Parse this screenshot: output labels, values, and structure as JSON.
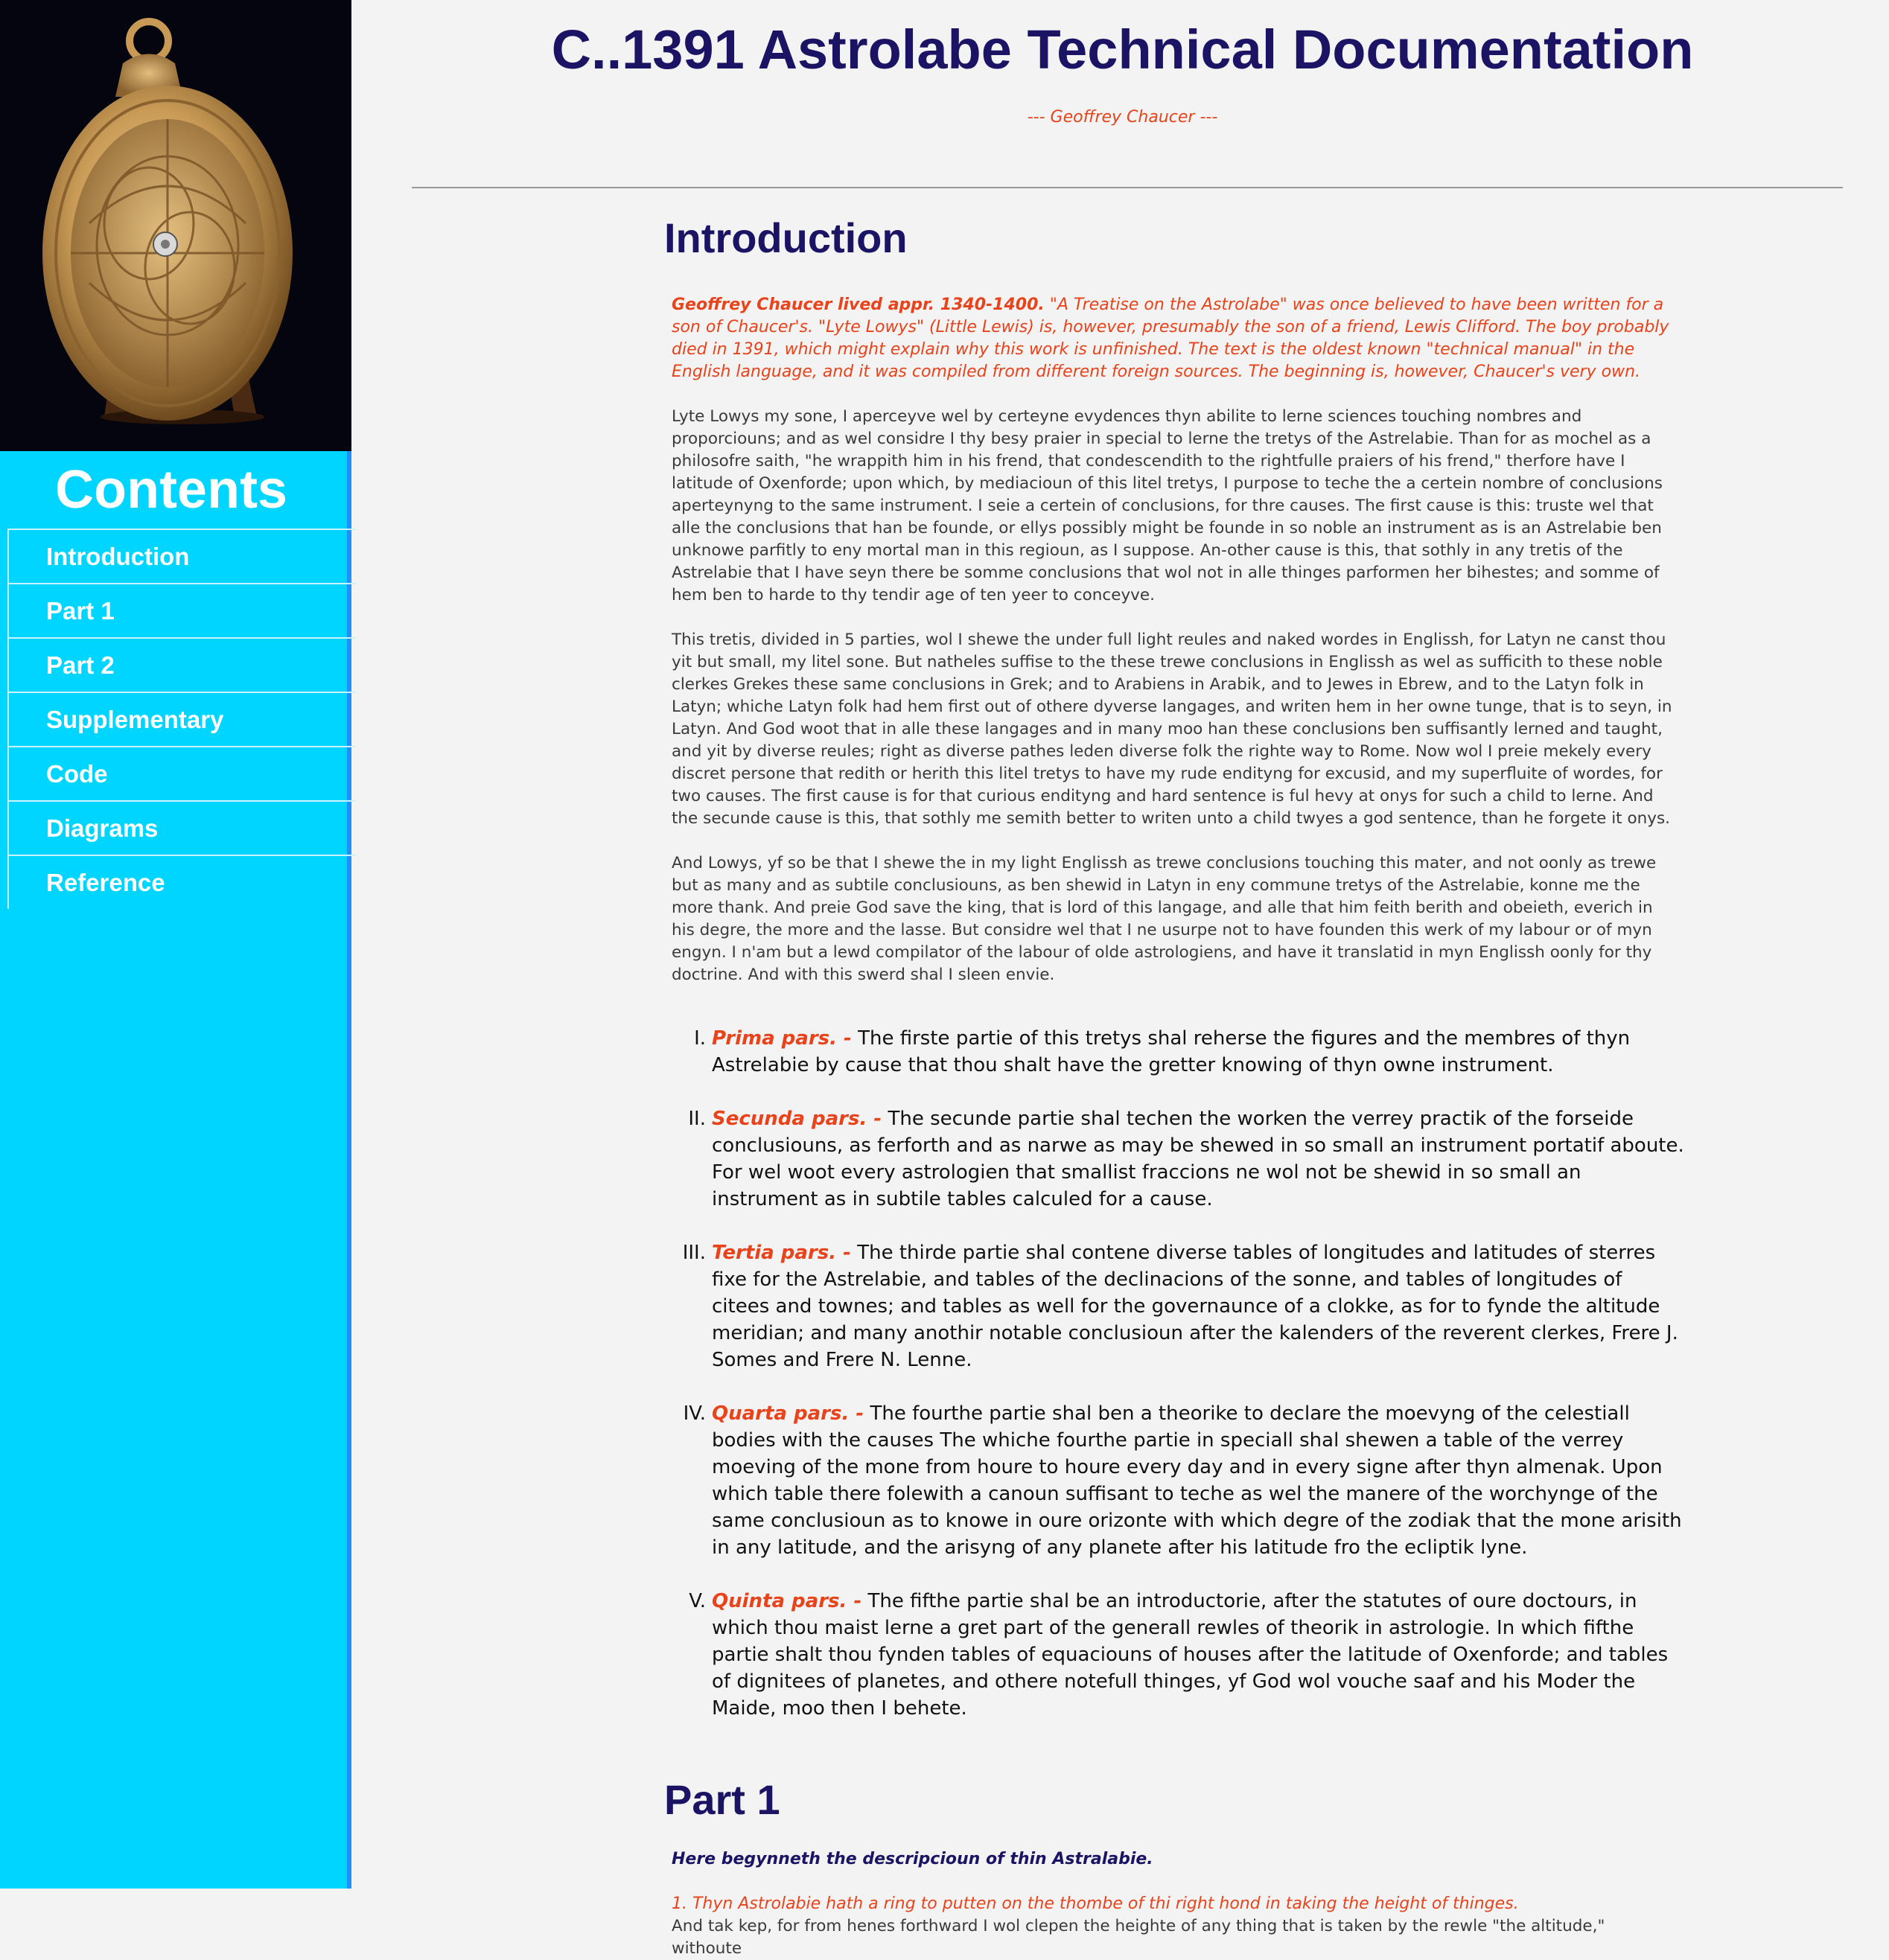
{
  "sidebar": {
    "image_alt": "astrolabe",
    "contents_title": "Contents",
    "nav": [
      {
        "label": "Introduction"
      },
      {
        "label": "Part 1"
      },
      {
        "label": "Part 2"
      },
      {
        "label": "Supplementary"
      },
      {
        "label": "Code"
      },
      {
        "label": "Diagrams"
      },
      {
        "label": "Reference"
      }
    ]
  },
  "header": {
    "title": "C..1391 Astrolabe Technical Documentation",
    "author": "--- Geoffrey Chaucer ---"
  },
  "intro": {
    "heading": "Introduction",
    "note_bold": "Geoffrey Chaucer lived appr. 1340-1400.",
    "note_text": " \"A Treatise on the Astrolabe\" was once believed to have been written for a son of Chaucer's. \"Lyte Lowys\" (Little Lewis) is, however, presumably the son of a friend, Lewis Clifford. The boy probably died in 1391, which might explain why this work is unfinished. The text is the oldest known \"technical manual\" in the English language, and it was compiled from different foreign sources. The beginning is, however, Chaucer's very own.",
    "paragraphs": [
      "Lyte Lowys my sone, I aperceyve wel by certeyne evydences thyn abilite to lerne sciences touching nombres and proporciouns; and as wel considre I thy besy praier in special to lerne the tretys of the Astrelabie. Than for as mochel as a philosofre saith, \"he wrappith him in his frend, that condescendith to the rightfulle praiers of his frend,\" therfore have I latitude of Oxenforde; upon which, by mediacioun of this litel tretys, I purpose to teche the a certein nombre of conclusions aperteynyng to the same instrument. I seie a certein of conclusions, for thre causes. The first cause is this: truste wel that alle the conclusions that han be founde, or ellys possibly might be founde in so noble an instrument as is an Astrelabie ben unknowe parfitly to eny mortal man in this regioun, as I suppose. An-other cause is this, that sothly in any tretis of the Astrelabie that I have seyn there be somme conclusions that wol not in alle thinges parformen her bihestes; and somme of hem ben to harde to thy tendir age of ten yeer to conceyve.",
      "This tretis, divided in 5 parties, wol I shewe the under full light reules and naked wordes in Englissh, for Latyn ne canst thou yit but small, my litel sone. But natheles suffise to the these trewe conclusions in Englissh as wel as sufficith to these noble clerkes Grekes these same conclusions in Grek; and to Arabiens in Arabik, and to Jewes in Ebrew, and to the Latyn folk in Latyn; whiche Latyn folk had hem first out of othere dyverse langages, and writen hem in her owne tunge, that is to seyn, in Latyn. And God woot that in alle these langages and in many moo han these conclusions ben suffisantly lerned and taught, and yit by diverse reules; right as diverse pathes leden diverse folk the righte way to Rome. Now wol I preie mekely every discret persone that redith or herith this litel tretys to have my rude endityng for excusid, and my superfluite of wordes, for two causes. The first cause is for that curious endityng and hard sentence is ful hevy at onys for such a child to lerne. And the secunde cause is this, that sothly me semith better to writen unto a child twyes a god sentence, than he forgete it onys.",
      "And Lowys, yf so be that I shewe the in my light Englissh as trewe conclusions touching this mater, and not oonly as trewe but as many and as subtile conclusiouns, as ben shewid in Latyn in eny commune tretys of the Astrelabie, konne me the more thank. And preie God save the king, that is lord of this langage, and alle that him feith berith and obeieth, everich in his degre, the more and the lasse. But considre wel that I ne usurpe not to have founden this werk of my labour or of myn engyn. I n'am but a lewd compilator of the labour of olde astrologiens, and have it translatid in myn Englissh oonly for thy doctrine. And with this swerd shal I sleen envie."
    ],
    "parts": [
      {
        "num": "I.",
        "name": "Prima pars. -",
        "text": " The firste partie of this tretys shal reherse the figures and the membres of thyn Astrelabie by cause that thou shalt have the gretter knowing of thyn owne instrument."
      },
      {
        "num": "II.",
        "name": "Secunda pars. -",
        "text": " The secunde partie shal techen the worken the verrey practik of the forseide conclusiouns, as ferforth and as narwe as may be shewed in so small an instrument portatif aboute. For wel woot every astrologien that smallist fraccions ne wol not be shewid in so small an instrument as in subtile tables calculed for a cause."
      },
      {
        "num": "III.",
        "name": "Tertia pars. -",
        "text": " The thirde partie shal contene diverse tables of longitudes and latitudes of sterres fixe for the Astrelabie, and tables of the declinacions of the sonne, and tables of longitudes of citees and townes; and tables as well for the governaunce of a clokke, as for to fynde the altitude meridian; and many anothir notable conclusioun after the kalenders of the reverent clerkes, Frere J. Somes and Frere N. Lenne."
      },
      {
        "num": "IV.",
        "name": "Quarta pars. -",
        "text": " The fourthe partie shal ben a theorike to declare the moevyng of the celestiall bodies with the causes The whiche fourthe partie in speciall shal shewen a table of the verrey moeving of the mone from houre to houre every day and in every signe after thyn almenak. Upon which table there folewith a canoun suffisant to teche as wel the manere of the worchynge of the same conclusioun as to knowe in oure orizonte with which degre of the zodiak that the mone arisith in any latitude, and the arisyng of any planete after his latitude fro the ecliptik lyne."
      },
      {
        "num": "V.",
        "name": "Quinta pars. -",
        "text": " The fifthe partie shal be an introductorie, after the statutes of oure doctours, in which thou maist lerne a gret part of the generall rewles of theorik in astrologie. In which fifthe partie shalt thou fynden tables of equaciouns of houses after the latitude of Oxenforde; and tables of dignitees of planetes, and othere notefull thinges, yf God wol vouche saaf and his Moder the Maide, moo then I behete."
      }
    ]
  },
  "part1": {
    "heading": "Part 1",
    "subtitle": "Here begynneth the descripcioun of thin Astralabie.",
    "item1": "1. Thyn Astrolabie hath a ring to putten on the thombe of thi right hond in taking the height of thinges.",
    "item1_text": "And tak kep, for from henes forthward I wol clepen the heighte of any thing that is taken by the rewle \"the altitude,\" withoute"
  }
}
